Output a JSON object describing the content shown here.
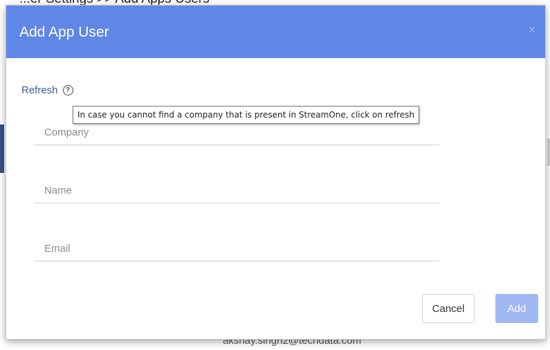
{
  "background": {
    "top_text": "...er Settings >> Add Apps Users",
    "bottom_text": "akshay.singh2@techdata.com"
  },
  "dialog": {
    "title": "Add App User",
    "close_icon": "close-icon",
    "refresh_label": "Refresh",
    "help_icon": "help-circle-icon",
    "tooltip": "In case you cannot find a company that is present in StreamOne, click on refresh",
    "fields": {
      "company": {
        "placeholder": "Company",
        "value": ""
      },
      "name": {
        "placeholder": "Name",
        "value": ""
      },
      "email": {
        "placeholder": "Email",
        "value": ""
      }
    },
    "buttons": {
      "cancel": "Cancel",
      "add": "Add"
    }
  },
  "colors": {
    "header": "#5f87e6",
    "add_button_disabled": "#9fb7f2",
    "link": "#3c5a9c"
  }
}
